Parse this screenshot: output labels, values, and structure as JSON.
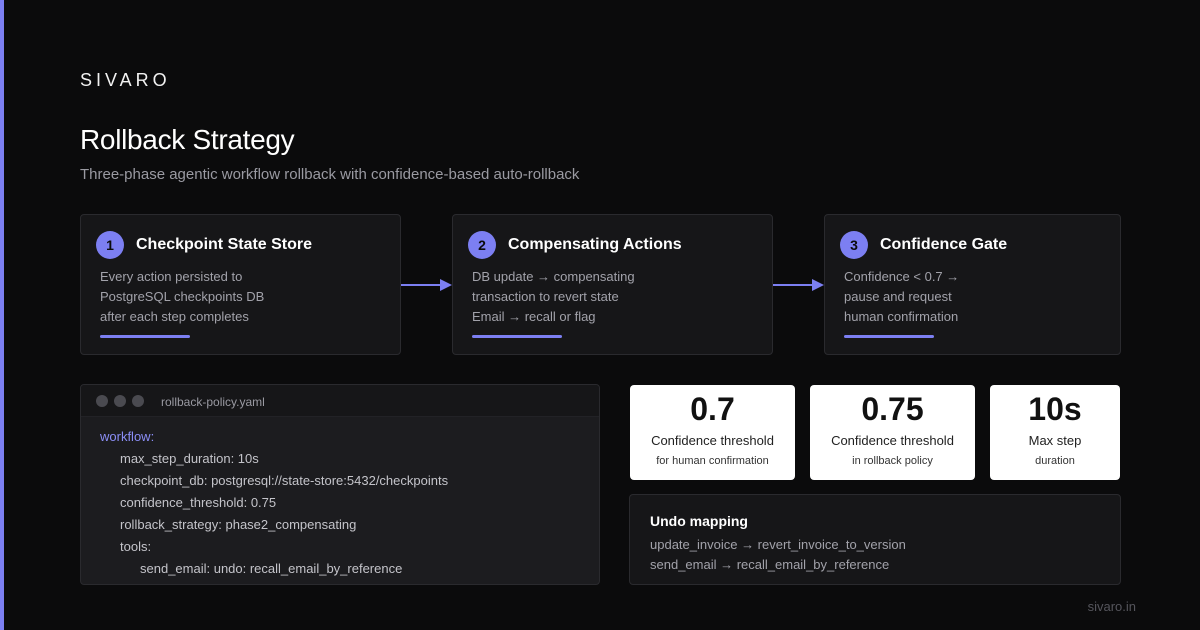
{
  "brand": "SIVARO",
  "title": "Rollback Strategy",
  "subtitle": "Three-phase agentic workflow rollback with confidence-based auto-rollback",
  "accent_color": "#7c7ff2",
  "phases": [
    {
      "number": "1",
      "title": "Checkpoint State Store",
      "lines": [
        "Every action persisted to",
        "PostgreSQL checkpoints DB",
        "after each step completes"
      ]
    },
    {
      "number": "2",
      "title": "Compensating Actions",
      "lines": [
        "DB update → compensating",
        "transaction to revert state",
        "Email → recall or flag"
      ]
    },
    {
      "number": "3",
      "title": "Confidence Gate",
      "lines": [
        "Confidence < 0.7 →",
        "pause and request",
        "human confirmation"
      ]
    }
  ],
  "code": {
    "filename": "rollback-policy.yaml",
    "lines": [
      "workflow:",
      "max_step_duration: 10s",
      "checkpoint_db: postgresql://state-store:5432/checkpoints",
      "confidence_threshold: 0.75",
      "rollback_strategy: phase2_compensating",
      "tools:",
      "send_email: undo: recall_email_by_reference"
    ]
  },
  "stats": [
    {
      "value": "0.7",
      "label": "Confidence threshold",
      "sub": "for human confirmation"
    },
    {
      "value": "0.75",
      "label": "Confidence threshold",
      "sub": "in rollback policy"
    },
    {
      "value": "10s",
      "label": "Max step",
      "sub": "duration"
    }
  ],
  "undo": {
    "title": "Undo mapping",
    "lines": [
      "update_invoice → revert_invoice_to_version",
      "send_email → recall_email_by_reference"
    ]
  },
  "footer": "sivaro.in"
}
